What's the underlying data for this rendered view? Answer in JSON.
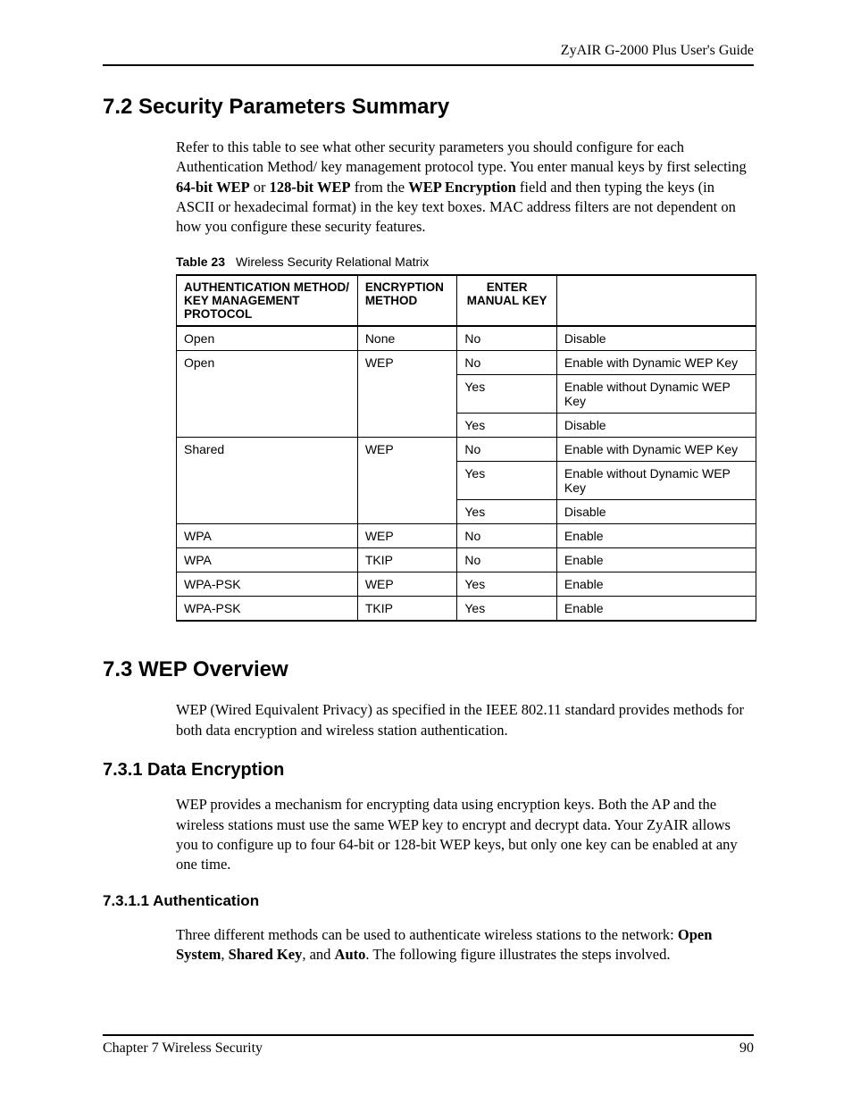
{
  "header": {
    "guide_title": "ZyAIR G-2000 Plus User's Guide"
  },
  "section72": {
    "heading": "7.2  Security Parameters Summary",
    "para_pre": "Refer to this table to see what other security parameters you should configure for each Authentication Method/ key management protocol type. You enter manual keys by first selecting ",
    "bold1": "64-bit WEP",
    "mid1": " or ",
    "bold2": "128-bit WEP",
    "mid2": " from the ",
    "bold3": "WEP Encryption",
    "para_post": " field and then typing the keys (in ASCII or hexadecimal format) in the key text boxes. MAC address filters are not dependent on how you configure these security features.",
    "table_caption_label": "Table 23",
    "table_caption_text": "Wireless Security Relational Matrix",
    "headers": {
      "h1": "AUTHENTICATION METHOD/ KEY MANAGEMENT PROTOCOL",
      "h2": "ENCRYPTION METHOD",
      "h3": "ENTER MANUAL KEY",
      "h4": ""
    },
    "rows": [
      {
        "auth": "Open",
        "enc": "None",
        "man": "No",
        "res": "Disable",
        "auth_rs": 1,
        "enc_rs": 1
      },
      {
        "auth": "Open",
        "enc": "WEP",
        "man": "No",
        "res": "Enable with Dynamic WEP Key",
        "auth_rs": 3,
        "enc_rs": 3
      },
      {
        "auth": "",
        "enc": "",
        "man": "Yes",
        "res": "Enable without Dynamic WEP Key"
      },
      {
        "auth": "",
        "enc": "",
        "man": "Yes",
        "res": "Disable"
      },
      {
        "auth": "Shared",
        "enc": "WEP",
        "man": "No",
        "res": "Enable with Dynamic WEP Key",
        "auth_rs": 3,
        "enc_rs": 3
      },
      {
        "auth": "",
        "enc": "",
        "man": "Yes",
        "res": "Enable without Dynamic WEP Key"
      },
      {
        "auth": "",
        "enc": "",
        "man": "Yes",
        "res": "Disable"
      },
      {
        "auth": "WPA",
        "enc": "WEP",
        "man": "No",
        "res": "Enable",
        "auth_rs": 1,
        "enc_rs": 1
      },
      {
        "auth": "WPA",
        "enc": "TKIP",
        "man": "No",
        "res": "Enable",
        "auth_rs": 1,
        "enc_rs": 1
      },
      {
        "auth": "WPA-PSK",
        "enc": "WEP",
        "man": "Yes",
        "res": "Enable",
        "auth_rs": 1,
        "enc_rs": 1
      },
      {
        "auth": "WPA-PSK",
        "enc": "TKIP",
        "man": "Yes",
        "res": "Enable",
        "auth_rs": 1,
        "enc_rs": 1
      }
    ]
  },
  "section73": {
    "heading": "7.3  WEP Overview",
    "para": "WEP (Wired Equivalent Privacy) as specified in the IEEE 802.11 standard provides methods for both data encryption and wireless station authentication."
  },
  "section731": {
    "heading": "7.3.1  Data Encryption",
    "para": "WEP provides a mechanism for encrypting data using encryption keys. Both the AP and the wireless stations must use the same WEP key to encrypt and decrypt data. Your ZyAIR allows you to configure up to four 64-bit or 128-bit WEP keys, but only one key can be enabled at any one time."
  },
  "section7311": {
    "heading": "7.3.1.1  Authentication",
    "para_pre": "Three different methods can be used to authenticate wireless stations to the network: ",
    "b1": "Open System",
    "s1": ", ",
    "b2": "Shared Key",
    "s2": ", and ",
    "b3": "Auto",
    "para_post": ". The following figure illustrates the steps involved."
  },
  "footer": {
    "left": "Chapter 7 Wireless Security",
    "right": "90"
  }
}
